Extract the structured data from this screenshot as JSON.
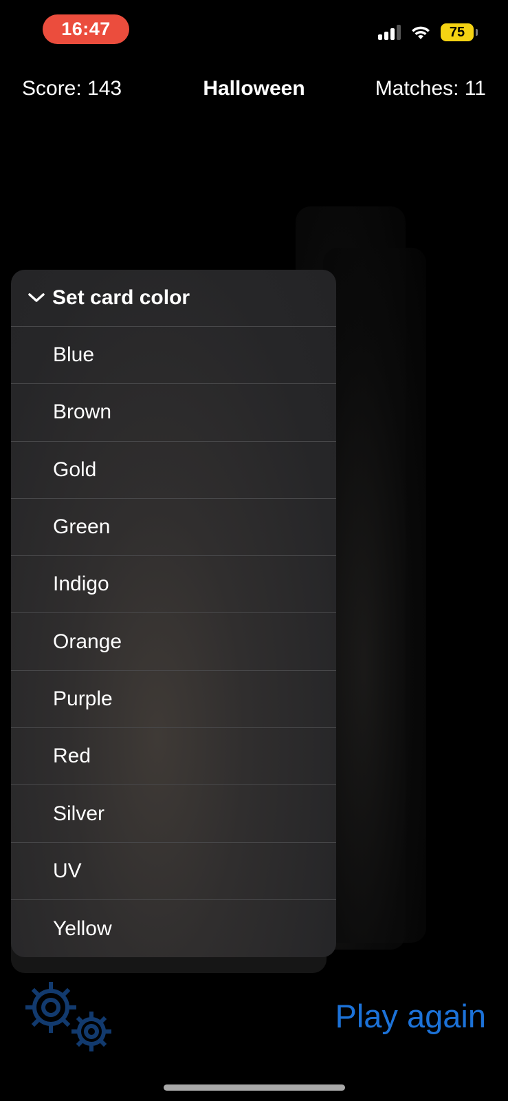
{
  "status_bar": {
    "time": "16:47",
    "battery": "75",
    "signal_icon": "cellular-signal-icon",
    "wifi_icon": "wifi-icon"
  },
  "header": {
    "score": "Score: 143",
    "title": "Halloween",
    "matches": "Matches: 11"
  },
  "menu": {
    "header_label": "Set card color",
    "items": [
      "Blue",
      "Brown",
      "Gold",
      "Green",
      "Indigo",
      "Orange",
      "Purple",
      "Red",
      "Silver",
      "UV",
      "Yellow"
    ]
  },
  "footer": {
    "settings_icon": "gears-icon",
    "play_again_label": "Play again"
  },
  "colors": {
    "accent": "#1c72d8",
    "time_pill": "#eb4d3d",
    "battery": "#f5d313",
    "gears": "#123a6e"
  }
}
